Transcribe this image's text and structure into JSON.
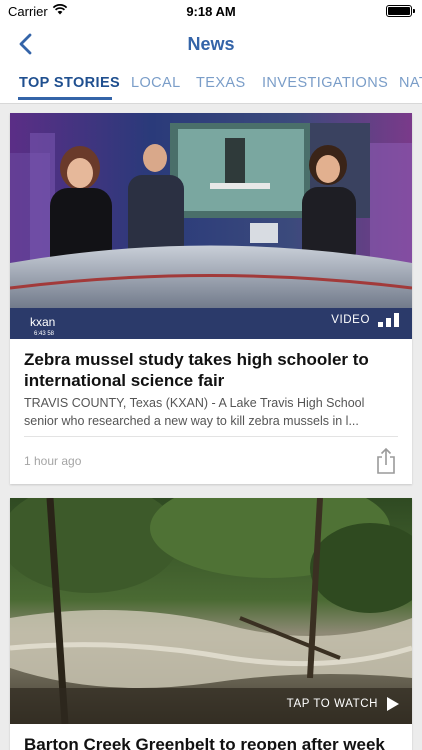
{
  "status_bar": {
    "carrier": "Carrier",
    "time": "9:18 AM"
  },
  "nav": {
    "title": "News",
    "back_icon": "chevron-left-icon"
  },
  "tabs": [
    {
      "label": "TOP STORIES",
      "active": true
    },
    {
      "label": "LOCAL",
      "active": false
    },
    {
      "label": "TEXAS",
      "active": false
    },
    {
      "label": "INVESTIGATIONS",
      "active": false
    },
    {
      "label": "NAT",
      "active": false
    }
  ],
  "colors": {
    "accent": "#3464a8",
    "tab_inactive": "#7a9dc8",
    "background": "#ececec"
  },
  "stories": [
    {
      "media_label": "VIDEO",
      "media_icon": "signal-bars-icon",
      "station_logo": "kxan",
      "clock_overlay": "6:43 58",
      "headline_lines": [
        "Zebra mussel study takes high schooler to",
        "international science fair"
      ],
      "summary_lines": [
        "TRAVIS COUNTY, Texas (KXAN) - A Lake Travis High School",
        "senior who researched a new way to kill zebra mussels in l..."
      ],
      "timestamp": "1 hour ago"
    },
    {
      "media_label": "TAP TO WATCH",
      "media_icon": "play-icon",
      "headline_lines": [
        "Barton Creek Greenbelt to reopen after week"
      ]
    }
  ]
}
